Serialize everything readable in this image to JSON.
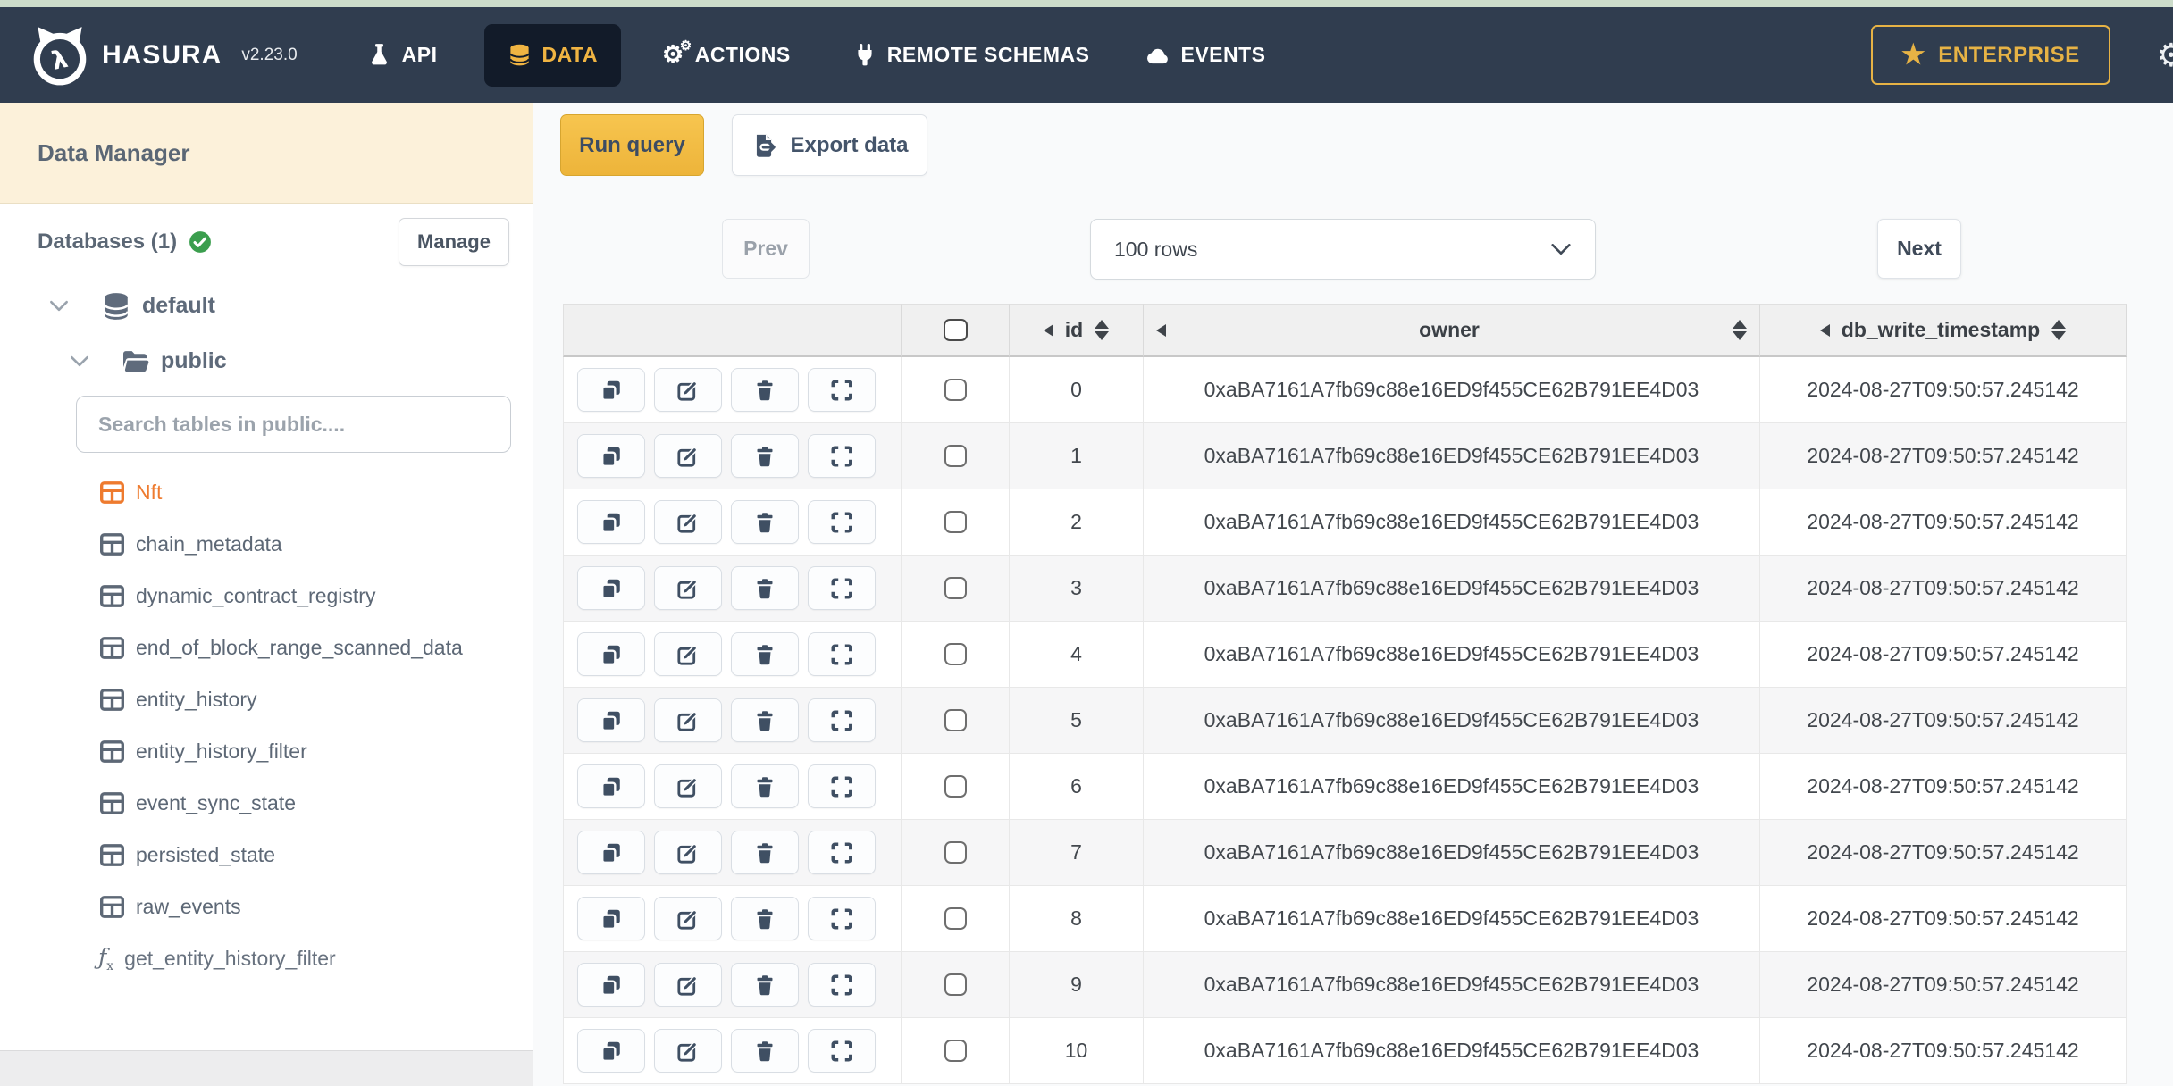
{
  "nav": {
    "brand": "HASURA",
    "version": "v2.23.0",
    "items": [
      {
        "label": "API",
        "icon": "flask-icon",
        "active": false
      },
      {
        "label": "DATA",
        "icon": "database-icon",
        "active": true
      },
      {
        "label": "ACTIONS",
        "icon": "gears-icon",
        "active": false
      },
      {
        "label": "REMOTE SCHEMAS",
        "icon": "plug-icon",
        "active": false
      },
      {
        "label": "EVENTS",
        "icon": "cloud-icon",
        "active": false
      }
    ],
    "enterprise_label": "ENTERPRISE",
    "icons_right": [
      "star-icon",
      "gear-icon"
    ]
  },
  "sidebar": {
    "title": "Data Manager",
    "databases_label": "Databases (1)",
    "databases_status_icon": "check-circle-icon",
    "manage_button": "Manage",
    "tree": {
      "database": "default",
      "schema": "public"
    },
    "search_placeholder": "Search tables in public....",
    "tables": [
      {
        "name": "Nft",
        "active": true
      },
      {
        "name": "chain_metadata",
        "active": false
      },
      {
        "name": "dynamic_contract_registry",
        "active": false
      },
      {
        "name": "end_of_block_range_scanned_data",
        "active": false
      },
      {
        "name": "entity_history",
        "active": false
      },
      {
        "name": "entity_history_filter",
        "active": false
      },
      {
        "name": "event_sync_state",
        "active": false
      },
      {
        "name": "persisted_state",
        "active": false
      },
      {
        "name": "raw_events",
        "active": false
      }
    ],
    "function_item": "get_entity_history_filter"
  },
  "toolbar": {
    "run_query": "Run query",
    "export_data": "Export data"
  },
  "pagination": {
    "prev": "Prev",
    "rows_selected": "100 rows",
    "next": "Next"
  },
  "table": {
    "columns": [
      "id",
      "owner",
      "db_write_timestamp"
    ],
    "row_action_icons": [
      "copy-icon",
      "edit-icon",
      "trash-icon",
      "expand-icon"
    ],
    "rows": [
      {
        "id": "0",
        "owner": "0xaBA7161A7fb69c88e16ED9f455CE62B791EE4D03",
        "db_write_timestamp": "2024-08-27T09:50:57.245142"
      },
      {
        "id": "1",
        "owner": "0xaBA7161A7fb69c88e16ED9f455CE62B791EE4D03",
        "db_write_timestamp": "2024-08-27T09:50:57.245142"
      },
      {
        "id": "2",
        "owner": "0xaBA7161A7fb69c88e16ED9f455CE62B791EE4D03",
        "db_write_timestamp": "2024-08-27T09:50:57.245142"
      },
      {
        "id": "3",
        "owner": "0xaBA7161A7fb69c88e16ED9f455CE62B791EE4D03",
        "db_write_timestamp": "2024-08-27T09:50:57.245142"
      },
      {
        "id": "4",
        "owner": "0xaBA7161A7fb69c88e16ED9f455CE62B791EE4D03",
        "db_write_timestamp": "2024-08-27T09:50:57.245142"
      },
      {
        "id": "5",
        "owner": "0xaBA7161A7fb69c88e16ED9f455CE62B791EE4D03",
        "db_write_timestamp": "2024-08-27T09:50:57.245142"
      },
      {
        "id": "6",
        "owner": "0xaBA7161A7fb69c88e16ED9f455CE62B791EE4D03",
        "db_write_timestamp": "2024-08-27T09:50:57.245142"
      },
      {
        "id": "7",
        "owner": "0xaBA7161A7fb69c88e16ED9f455CE62B791EE4D03",
        "db_write_timestamp": "2024-08-27T09:50:57.245142"
      },
      {
        "id": "8",
        "owner": "0xaBA7161A7fb69c88e16ED9f455CE62B791EE4D03",
        "db_write_timestamp": "2024-08-27T09:50:57.245142"
      },
      {
        "id": "9",
        "owner": "0xaBA7161A7fb69c88e16ED9f455CE62B791EE4D03",
        "db_write_timestamp": "2024-08-27T09:50:57.245142"
      },
      {
        "id": "10",
        "owner": "0xaBA7161A7fb69c88e16ED9f455CE62B791EE4D03",
        "db_write_timestamp": "2024-08-27T09:50:57.245142"
      }
    ]
  },
  "colors": {
    "navbar_bg": "#303d4f",
    "active_tab_bg": "#121b29",
    "brand_yellow": "#f0b442",
    "enterprise_gold": "#e7b345",
    "run_query_amber": "#f2bc44",
    "sidebar_header_cream": "#fcf1da",
    "selected_table_orange": "#ee7b2f",
    "check_green": "#3b9e4e",
    "table_header_bg": "#f0f0f0",
    "row_stripe": "#f6f6f7",
    "main_bg": "#f9fafb",
    "top_strip": "#ccdcca"
  }
}
